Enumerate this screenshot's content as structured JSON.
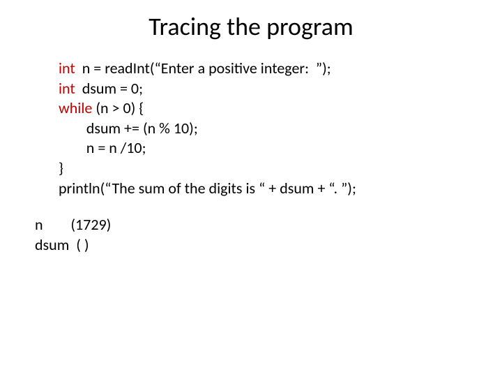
{
  "title": "Tracing the program",
  "code": {
    "kw_int1": "int",
    "line1_rest": "  n = readInt(“Enter a positive integer:  ”);",
    "kw_int2": "int",
    "line2_rest": "  dsum = 0;",
    "kw_while": "while",
    "line3_rest": " (n > 0) {",
    "line4": "        dsum += (n % 10);",
    "line5": "        n = n /10;",
    "line6": "}",
    "line7": "println(“The sum of the digits is “ + dsum + “. ”);"
  },
  "trace": {
    "n_label": "n",
    "n_value": "(1729)",
    "dsum_label": "dsum",
    "dsum_value": "( )"
  }
}
